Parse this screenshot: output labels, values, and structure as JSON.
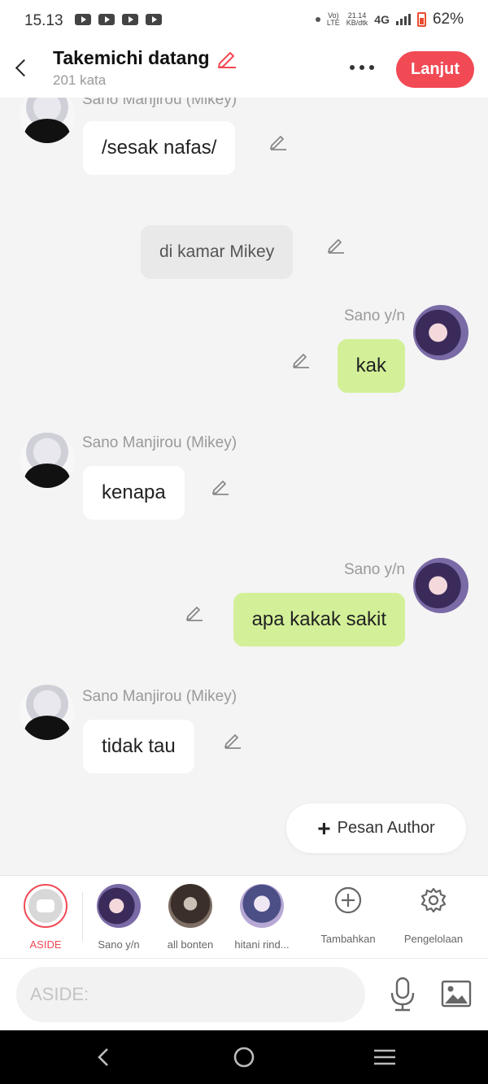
{
  "status_bar": {
    "time": "15.13",
    "volte_top": "Vo)",
    "volte_bottom": "LTE",
    "speed_top": "21.14",
    "speed_bottom": "KB/dtk",
    "network": "4G",
    "battery": "62%"
  },
  "header": {
    "title": "Takemichi datang",
    "word_count": "201 kata",
    "continue_label": "Lanjut",
    "accent_color": "#f14a55"
  },
  "chat": {
    "messages": [
      {
        "type": "left",
        "sender": "Sano Manjirou (Mikey)",
        "text": "/sesak nafas/"
      },
      {
        "type": "narration",
        "text": "di kamar Mikey"
      },
      {
        "type": "right",
        "sender": "Sano y/n",
        "text": "kak"
      },
      {
        "type": "left",
        "sender": "Sano Manjirou (Mikey)",
        "text": "kenapa"
      },
      {
        "type": "right",
        "sender": "Sano y/n",
        "text": "apa kakak sakit"
      },
      {
        "type": "left",
        "sender": "Sano Manjirou (Mikey)",
        "text": "tidak tau"
      }
    ],
    "author_message_label": "Pesan Author"
  },
  "character_bar": {
    "items": [
      {
        "label": "ASIDE"
      },
      {
        "label": "Sano y/n"
      },
      {
        "label": "all bonten"
      },
      {
        "label": "hitani rind..."
      }
    ],
    "add_label": "Tambahkan",
    "manage_label": "Pengelolaan"
  },
  "input_bar": {
    "placeholder": "ASIDE:"
  }
}
